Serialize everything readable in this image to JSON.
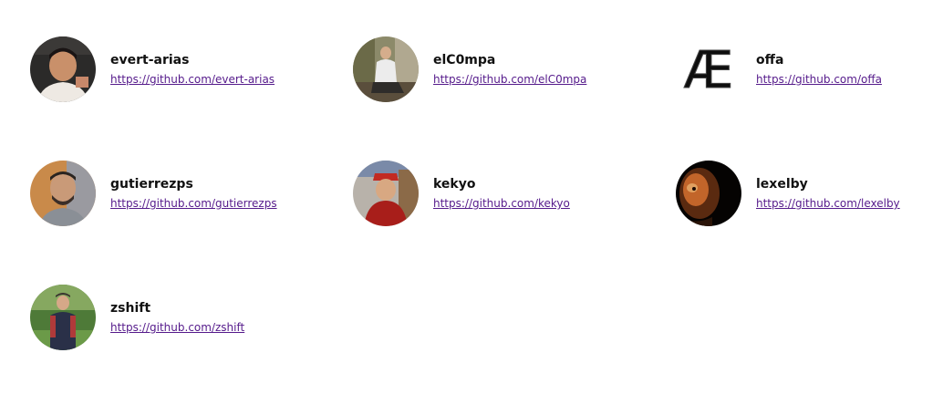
{
  "contributors": [
    {
      "username": "evert-arias",
      "url": "https://github.com/evert-arias",
      "avatar": "photo-avatar"
    },
    {
      "username": "elC0mpa",
      "url": "https://github.com/elC0mpa",
      "avatar": "photo-avatar"
    },
    {
      "username": "offa",
      "url": "https://github.com/offa",
      "avatar": "ae-logo-avatar",
      "avatar_text": "Æ"
    },
    {
      "username": "gutierrezps",
      "url": "https://github.com/gutierrezps",
      "avatar": "photo-avatar"
    },
    {
      "username": "kekyo",
      "url": "https://github.com/kekyo",
      "avatar": "photo-avatar"
    },
    {
      "username": "lexelby",
      "url": "https://github.com/lexelby",
      "avatar": "photo-avatar"
    },
    {
      "username": "zshift",
      "url": "https://github.com/zshift",
      "avatar": "photo-avatar"
    }
  ],
  "colors": {
    "link": "#551a8b",
    "text": "#111111",
    "background": "#ffffff"
  }
}
